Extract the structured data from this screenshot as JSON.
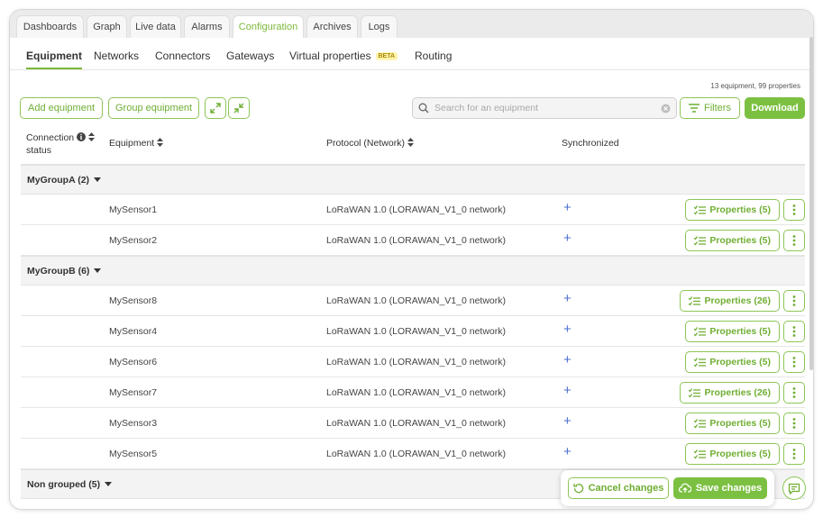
{
  "tabs": [
    {
      "label": "Dashboards",
      "active": false
    },
    {
      "label": "Graph",
      "active": false
    },
    {
      "label": "Live data",
      "active": false
    },
    {
      "label": "Alarms",
      "active": false
    },
    {
      "label": "Configuration",
      "active": true
    },
    {
      "label": "Archives",
      "active": false
    },
    {
      "label": "Logs",
      "active": false
    }
  ],
  "subtabs": {
    "equipment": "Equipment",
    "networks": "Networks",
    "connectors": "Connectors",
    "gateways": "Gateways",
    "virtual_properties": "Virtual properties",
    "beta_badge": "BETA",
    "routing": "Routing"
  },
  "summary": "13 equipment, 99 properties",
  "toolbar": {
    "add_equipment": "Add equipment",
    "group_equipment": "Group equipment",
    "expand_icon": "expand-icon",
    "collapse_icon": "collapse-icon",
    "search_placeholder": "Search for an equipment",
    "filters": "Filters",
    "download": "Download"
  },
  "table": {
    "col_connection_line1": "Connection",
    "col_connection_line2": "status",
    "col_equipment": "Equipment",
    "col_protocol": "Protocol (Network)",
    "col_synchronized": "Synchronized"
  },
  "groups": [
    {
      "name": "MyGroupA (2)",
      "rows": [
        {
          "equipment": "MySensor1",
          "protocol": "LoRaWAN 1.0 (LORAWAN_V1_0 network)",
          "sync": "+",
          "properties": "Properties (5)"
        },
        {
          "equipment": "MySensor2",
          "protocol": "LoRaWAN 1.0 (LORAWAN_V1_0 network)",
          "sync": "+",
          "properties": "Properties (5)"
        }
      ]
    },
    {
      "name": "MyGroupB (6)",
      "rows": [
        {
          "equipment": "MySensor8",
          "protocol": "LoRaWAN 1.0 (LORAWAN_V1_0 network)",
          "sync": "+",
          "properties": "Properties (26)"
        },
        {
          "equipment": "MySensor4",
          "protocol": "LoRaWAN 1.0 (LORAWAN_V1_0 network)",
          "sync": "+",
          "properties": "Properties (5)"
        },
        {
          "equipment": "MySensor6",
          "protocol": "LoRaWAN 1.0 (LORAWAN_V1_0 network)",
          "sync": "+",
          "properties": "Properties (5)"
        },
        {
          "equipment": "MySensor7",
          "protocol": "LoRaWAN 1.0 (LORAWAN_V1_0 network)",
          "sync": "+",
          "properties": "Properties (26)"
        },
        {
          "equipment": "MySensor3",
          "protocol": "LoRaWAN 1.0 (LORAWAN_V1_0 network)",
          "sync": "+",
          "properties": "Properties (5)"
        },
        {
          "equipment": "MySensor5",
          "protocol": "LoRaWAN 1.0 (LORAWAN_V1_0 network)",
          "sync": "+",
          "properties": "Properties (5)"
        }
      ]
    },
    {
      "name": "Non grouped (5)",
      "rows": []
    }
  ],
  "footer": {
    "cancel": "Cancel changes",
    "save": "Save changes"
  },
  "colors": {
    "accent": "#7cc042",
    "accent_text": "#6fae32",
    "sync_plus": "#4a6fd0"
  }
}
